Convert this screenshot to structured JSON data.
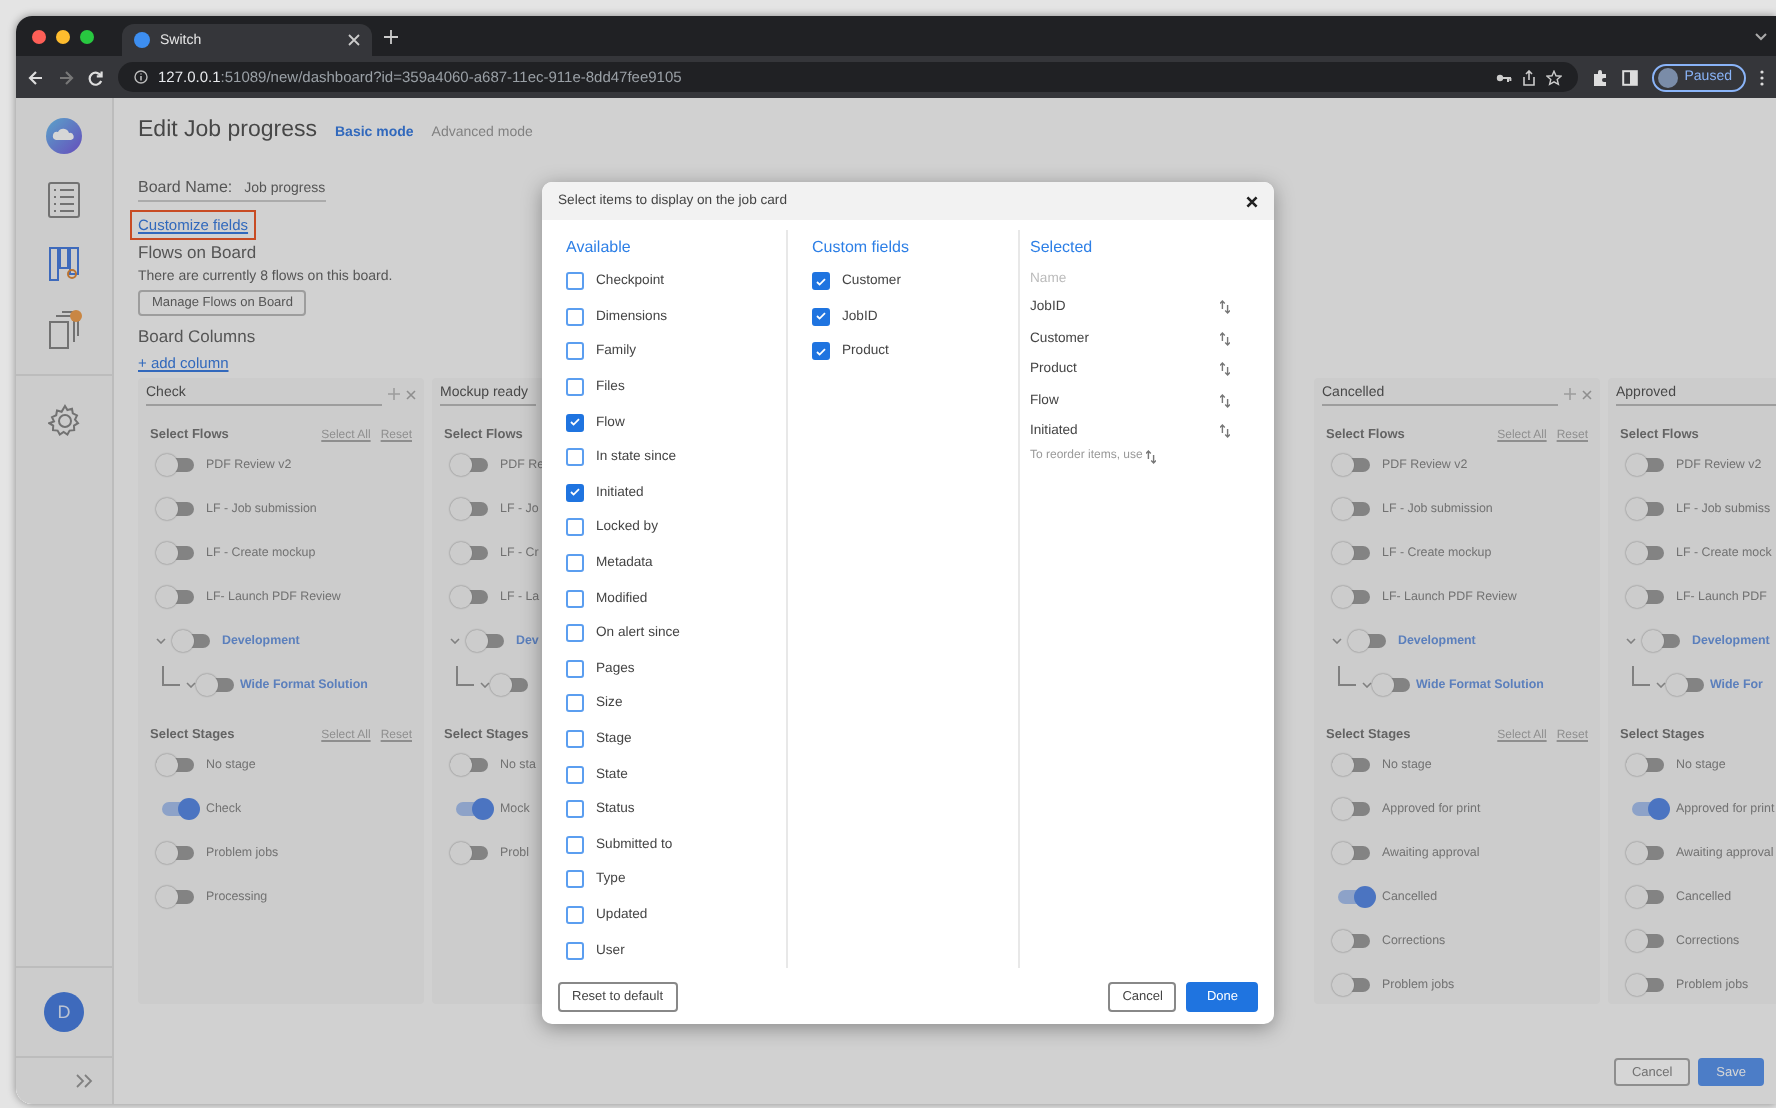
{
  "browser": {
    "tab_title": "Switch",
    "url_host": "127.0.0.1",
    "url_path": ":51089/new/dashboard?id=359a4060-a687-11ec-911e-8dd47fee9105",
    "profile_label": "Paused"
  },
  "sidebar": {
    "avatar": "D"
  },
  "editor": {
    "title": "Edit Job progress",
    "modes": [
      {
        "label": "Basic mode",
        "selected": true
      },
      {
        "label": "Advanced mode",
        "selected": false
      }
    ],
    "board_name_label": "Board Name:",
    "board_name_value": "Job progress",
    "customize_link": {
      "label": "Customize fields",
      "highlighted": true
    },
    "flows_heading": "Flows on Board",
    "flows_text": "There are currently 8 flows on this board.",
    "manage_button": "Manage Flows on Board",
    "columns_heading": "Board Columns",
    "add_column": "+ add column",
    "columns": [
      {
        "name": "Check",
        "flows_label": "Select Flows",
        "select_all": "Select All",
        "reset": "Reset",
        "flows": [
          {
            "label": "PDF Review v2",
            "on": false
          },
          {
            "label": "LF - Job submission",
            "on": false
          },
          {
            "label": "LF - Create mockup",
            "on": false
          },
          {
            "label": "LF- Launch PDF Review",
            "on": false
          },
          {
            "label": "Development",
            "on": false,
            "children": [
              {
                "label": "Wide Format Solution",
                "on": false
              }
            ]
          }
        ],
        "stages_label": "Select Stages",
        "stages_select_all": "Select All",
        "stages_reset": "Reset",
        "stages": [
          {
            "label": "No stage",
            "on": false
          },
          {
            "label": "Check",
            "on": true
          },
          {
            "label": "Problem jobs",
            "on": false
          },
          {
            "label": "Processing",
            "on": false
          }
        ]
      },
      {
        "name": "Mockup ready",
        "flows_label": "Select Flows",
        "flows": [
          {
            "label": "PDF Re",
            "on": false
          },
          {
            "label": "LF - Jo",
            "on": false
          },
          {
            "label": "LF - Cr",
            "on": false
          },
          {
            "label": "LF - La",
            "on": false
          },
          {
            "label": "Dev",
            "on": false,
            "children": [
              {
                "on": false
              }
            ]
          }
        ],
        "stages_label": "Select Stages",
        "stages": [
          {
            "label": "No sta",
            "on": false
          },
          {
            "label": "Mock",
            "on": true
          },
          {
            "label": "Probl",
            "on": false
          }
        ]
      },
      {
        "name": "Cancelled",
        "flows_label": "Select Flows",
        "select_all": "Select All",
        "reset": "Reset",
        "flows": [
          {
            "label": "PDF Review v2",
            "on": false
          },
          {
            "label": "LF - Job submission",
            "on": false
          },
          {
            "label": "LF - Create mockup",
            "on": false
          },
          {
            "label": "LF- Launch PDF Review",
            "on": false
          },
          {
            "label": "Development",
            "on": false,
            "children": [
              {
                "label": "Wide Format Solution",
                "on": false
              }
            ]
          }
        ],
        "stages_label": "Select Stages",
        "stages_select_all": "Select All",
        "stages_reset": "Reset",
        "stages": [
          {
            "label": "No stage",
            "on": false
          },
          {
            "label": "Approved for print",
            "on": false
          },
          {
            "label": "Awaiting approval",
            "on": false
          },
          {
            "label": "Cancelled",
            "on": true
          },
          {
            "label": "Corrections",
            "on": false
          },
          {
            "label": "Problem jobs",
            "on": false
          }
        ]
      },
      {
        "name": "Approved",
        "flows_label": "Select Flows",
        "flows": [
          {
            "label": "PDF Review v2",
            "on": false
          },
          {
            "label": "LF - Job submiss",
            "on": false
          },
          {
            "label": "LF - Create mock",
            "on": false
          },
          {
            "label": "LF- Launch PDF",
            "on": false
          },
          {
            "label": "Development",
            "on": false,
            "children": [
              {
                "label": "Wide For",
                "on": false
              }
            ]
          }
        ],
        "stages_label": "Select Stages",
        "stages": [
          {
            "label": "No stage",
            "on": false
          },
          {
            "label": "Approved for print",
            "on": true
          },
          {
            "label": "Awaiting approval",
            "on": false
          },
          {
            "label": "Cancelled",
            "on": false
          },
          {
            "label": "Corrections",
            "on": false
          },
          {
            "label": "Problem jobs",
            "on": false
          }
        ]
      }
    ],
    "footer_buttons": {
      "cancel": "Cancel",
      "save": "Save"
    }
  },
  "dialog": {
    "title": "Select items to display on the job card",
    "available": {
      "heading": "Available",
      "items": [
        {
          "label": "Checkpoint",
          "checked": false
        },
        {
          "label": "Dimensions",
          "checked": false
        },
        {
          "label": "Family",
          "checked": false
        },
        {
          "label": "Files",
          "checked": false
        },
        {
          "label": "Flow",
          "checked": true
        },
        {
          "label": "In state since",
          "checked": false
        },
        {
          "label": "Initiated",
          "checked": true
        },
        {
          "label": "Locked by",
          "checked": false
        },
        {
          "label": "Metadata",
          "checked": false
        },
        {
          "label": "Modified",
          "checked": false
        },
        {
          "label": "On alert since",
          "checked": false
        },
        {
          "label": "Pages",
          "checked": false
        },
        {
          "label": "Size",
          "checked": false
        },
        {
          "label": "Stage",
          "checked": false
        },
        {
          "label": "State",
          "checked": false
        },
        {
          "label": "Status",
          "checked": false
        },
        {
          "label": "Submitted to",
          "checked": false
        },
        {
          "label": "Type",
          "checked": false
        },
        {
          "label": "Updated",
          "checked": false
        },
        {
          "label": "User",
          "checked": false
        }
      ]
    },
    "custom_fields": {
      "heading": "Custom fields",
      "items": [
        {
          "label": "Customer",
          "checked": true
        },
        {
          "label": "JobID",
          "checked": true
        },
        {
          "label": "Product",
          "checked": true
        }
      ]
    },
    "selected": {
      "heading": "Selected",
      "column_header": "Name",
      "items": [
        "JobID",
        "Customer",
        "Product",
        "Flow",
        "Initiated"
      ],
      "hint": "To reorder items, use"
    },
    "buttons": {
      "reset": "Reset to default",
      "cancel": "Cancel",
      "done": "Done"
    }
  }
}
